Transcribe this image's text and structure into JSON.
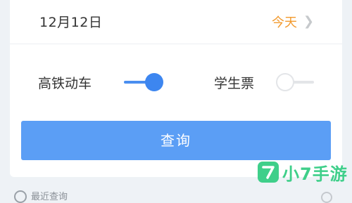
{
  "date_row": {
    "date": "12月12日",
    "today_label": "今天",
    "chevron": "chevron-right-icon"
  },
  "options": {
    "high_speed": {
      "label": "高铁动车",
      "enabled": true
    },
    "student": {
      "label": "学生票",
      "enabled": false
    }
  },
  "query_button": {
    "label": "查询"
  },
  "bottom": {
    "text": "最近查询"
  },
  "watermark": {
    "text": "小7手游"
  },
  "colors": {
    "accent": "#4a8ef0",
    "button": "#5b9ef5",
    "today": "#f29a2e",
    "watermark": "#3fcf8a"
  }
}
